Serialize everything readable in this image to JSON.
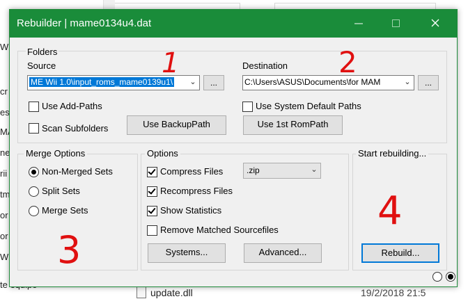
{
  "background": {
    "sidebar_fragments": [
      "Wi",
      "cr",
      "esp",
      "MA",
      "nec",
      "rii",
      "tm",
      "or",
      "or",
      "Wi",
      "te equipo"
    ],
    "file_name": "update.dll",
    "file_date": "19/2/2018 21:5"
  },
  "window": {
    "title": "Rebuilder | mame0134u4.dat",
    "minimize_glyph": "—",
    "maximize_glyph": "☐",
    "close_glyph": "✕"
  },
  "folders": {
    "label": "Folders",
    "source_label": "Source",
    "source_value": "ME Wii 1.0\\input_roms_mame0139u1\\",
    "browse_label": "...",
    "destination_label": "Destination",
    "destination_value": "C:\\Users\\ASUS\\Documents\\for MAM",
    "use_add_paths": "Use Add-Paths",
    "scan_subfolders": "Scan Subfolders",
    "use_backup_path": "Use BackupPath",
    "use_system_default_paths": "Use System Default Paths",
    "use_1st_rompath": "Use 1st RomPath"
  },
  "merge_options": {
    "label": "Merge Options",
    "items": [
      "Non-Merged Sets",
      "Split Sets",
      "Merge Sets"
    ],
    "selected": "Non-Merged Sets"
  },
  "options": {
    "label": "Options",
    "compress_files": "Compress Files",
    "compress_format": ".zip",
    "recompress_files": "Recompress Files",
    "show_statistics": "Show Statistics",
    "remove_matched": "Remove Matched Sourcefiles",
    "systems_button": "Systems...",
    "advanced_button": "Advanced..."
  },
  "start": {
    "label": "Start rebuilding...",
    "rebuild_button": "Rebuild..."
  },
  "annotations": {
    "one": "1",
    "two": "2",
    "three": "3",
    "four": "4",
    "color": "#e01010"
  },
  "colors": {
    "titlebar": "#1a8c3a",
    "selection": "#0078d7"
  }
}
